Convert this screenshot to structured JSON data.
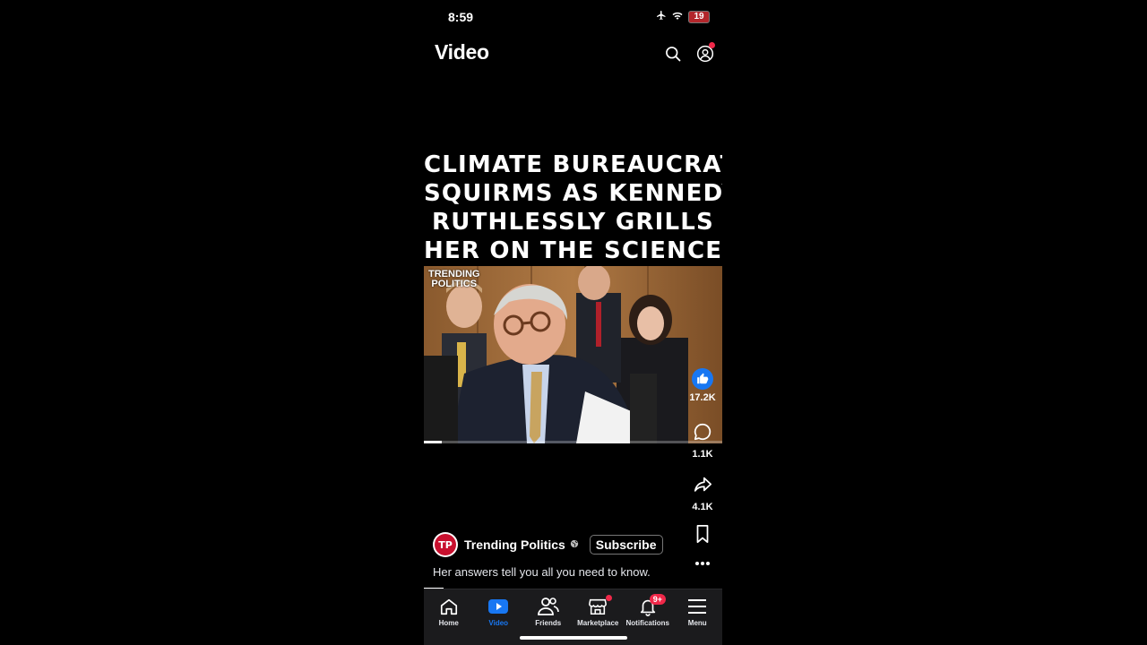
{
  "status_bar": {
    "time": "8:59",
    "battery": "19"
  },
  "header": {
    "title": "Video"
  },
  "post": {
    "headline_lines": [
      "CLIMATE BUREAUCRAT",
      "SQUIRMS AS KENNEDY",
      "RUTHLESSLY GRILLS",
      "HER ON THE SCIENCE"
    ],
    "watermark_line1": "TRENDING",
    "watermark_line2": "POLITICS",
    "video_progress": 0.06,
    "author_name": "Trending Politics",
    "avatar_initials": "TP",
    "subscribe_label": "Subscribe",
    "caption": "Her answers tell you all you need to know."
  },
  "actions": {
    "likes": "17.2K",
    "comments": "1.1K",
    "shares": "4.1K"
  },
  "nav": {
    "items": [
      {
        "label": "Home",
        "icon": "home-icon"
      },
      {
        "label": "Video",
        "icon": "video-icon",
        "active": true
      },
      {
        "label": "Friends",
        "icon": "friends-icon"
      },
      {
        "label": "Marketplace",
        "icon": "marketplace-icon"
      },
      {
        "label": "Notifications",
        "icon": "bell-icon",
        "badge": "9+"
      },
      {
        "label": "Menu",
        "icon": "menu-icon"
      }
    ]
  },
  "colors": {
    "accent": "#1877f2",
    "badge": "#f02849",
    "background": "#000000"
  }
}
